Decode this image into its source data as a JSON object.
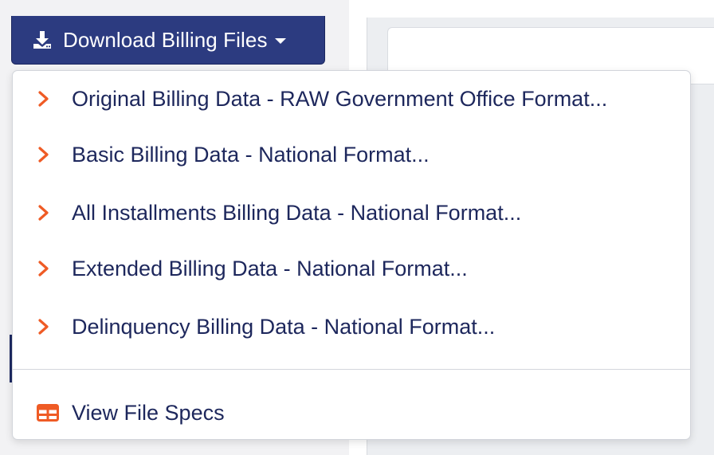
{
  "download_button": {
    "label": "Download Billing Files",
    "icon": "download-icon",
    "caret": "caret-down-icon"
  },
  "menu": {
    "items": [
      {
        "label": "Original Billing Data - RAW Government Office Format...",
        "icon": "chevron-right-icon"
      },
      {
        "label": "Basic Billing Data - National Format...",
        "icon": "chevron-right-icon"
      },
      {
        "label": "All Installments Billing Data - National Format...",
        "icon": "chevron-right-icon"
      },
      {
        "label": "Extended Billing Data - National Format...",
        "icon": "chevron-right-icon"
      },
      {
        "label": "Delinquency Billing Data - National Format...",
        "icon": "chevron-right-icon"
      }
    ],
    "spec_link": {
      "label": "View File Specs",
      "icon": "table-icon"
    }
  },
  "colors": {
    "button_bg": "#2c3b80",
    "menu_text": "#1d275c",
    "accent": "#ef5b25",
    "divider": "#d3d6dc"
  }
}
